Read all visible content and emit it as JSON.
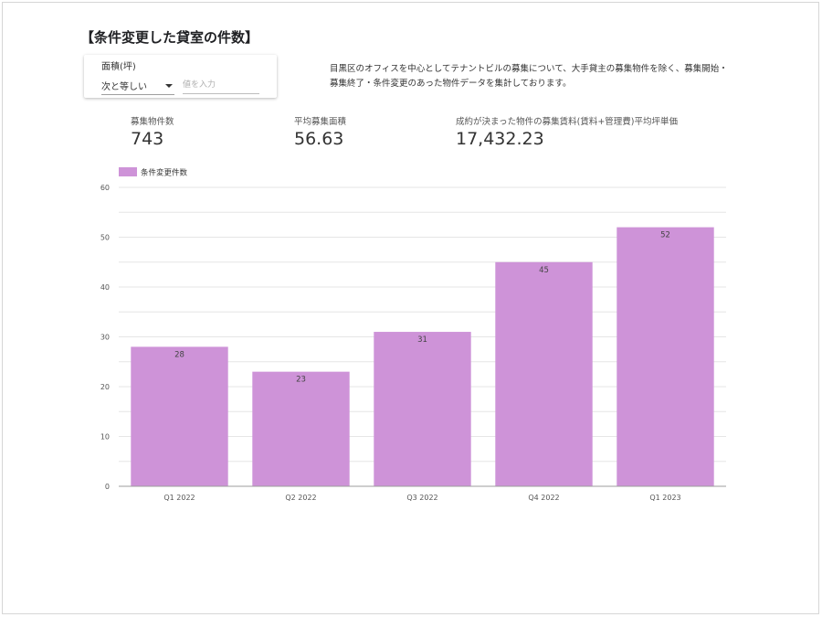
{
  "page": {
    "title": "【条件変更した貸室の件数】",
    "description": "目黒区のオフィスを中心としてテナントビルの募集について、大手貸主の募集物件を除く、募集開始・募集終了・条件変更のあった物件データを集計しております。"
  },
  "filter": {
    "label": "面積(坪)",
    "operator": "次と等しい",
    "placeholder": "値を入力"
  },
  "kpis": [
    {
      "label": "募集物件数",
      "value": "743"
    },
    {
      "label": "平均募集面積",
      "value": "56.63"
    },
    {
      "label": "成約が決まった物件の募集賃料(賃料+管理費)平均坪単価",
      "value": "17,432.23"
    }
  ],
  "chart_data": {
    "type": "bar",
    "categories": [
      "Q1 2022",
      "Q2 2022",
      "Q3 2022",
      "Q4 2022",
      "Q1 2023"
    ],
    "series": [
      {
        "name": "条件変更件数",
        "values": [
          28,
          23,
          31,
          45,
          52
        ],
        "color": "#ce93d8"
      }
    ],
    "ylim": [
      0,
      60
    ],
    "yticks": [
      0,
      10,
      20,
      30,
      40,
      50,
      60
    ],
    "grid": true,
    "legend_position": "top-left",
    "data_labels": true
  }
}
